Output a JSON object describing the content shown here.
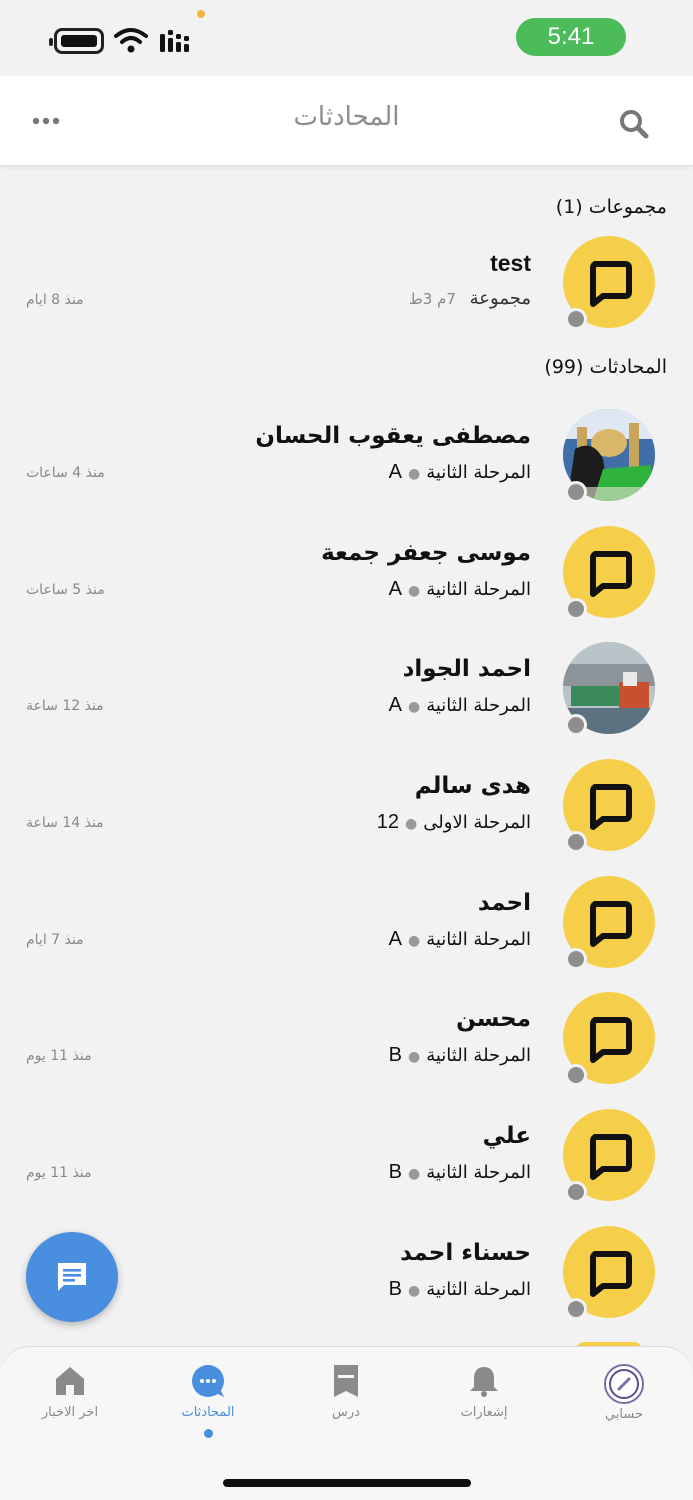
{
  "status_bar": {
    "time": "5:41",
    "icons": [
      "battery-icon",
      "wifi-icon",
      "signal-icon"
    ],
    "time_pill_color": "#4cbb5a"
  },
  "header": {
    "title": "المحادثات",
    "left_icon": "more-icon",
    "right_icon": "search-icon"
  },
  "groups_section": {
    "heading": "مجموعات (1)",
    "items": [
      {
        "name": "test",
        "label": "مجموعة",
        "meta": "7م 3ط",
        "time": "منذ 8 ايام",
        "avatar": "chat-bubble-icon"
      }
    ]
  },
  "chats_section": {
    "heading": "المحادثات (99)",
    "items": [
      {
        "name": "مصطفى يعقوب الحسان",
        "stage": "المرحلة الثانية",
        "section": "A",
        "time": "منذ 4 ساعات",
        "avatar": "photo-mosque"
      },
      {
        "name": "موسى جعفر جمعة",
        "stage": "المرحلة الثانية",
        "section": "A",
        "time": "منذ 5 ساعات",
        "avatar": "chat-bubble-icon"
      },
      {
        "name": "احمد الجواد",
        "stage": "المرحلة الثانية",
        "section": "A",
        "time": "منذ 12 ساعة",
        "avatar": "photo-ship"
      },
      {
        "name": "هدى سالم",
        "stage": "المرحلة الاولى",
        "section": "12",
        "time": "منذ 14 ساعة",
        "avatar": "chat-bubble-icon"
      },
      {
        "name": "احمد",
        "stage": "المرحلة الثانية",
        "section": "A",
        "time": "منذ 7 ايام",
        "avatar": "chat-bubble-icon"
      },
      {
        "name": "محسن",
        "stage": "المرحلة الثانية",
        "section": "B",
        "time": "منذ 11 يوم",
        "avatar": "chat-bubble-icon"
      },
      {
        "name": "علي",
        "stage": "المرحلة الثانية",
        "section": "B",
        "time": "منذ 11 يوم",
        "avatar": "chat-bubble-icon"
      },
      {
        "name": "حسناء احمد",
        "stage": "المرحلة الثانية",
        "section": "B",
        "time": "",
        "avatar": "chat-bubble-icon"
      }
    ]
  },
  "fab": {
    "icon": "message-icon",
    "color": "#4a8ee0"
  },
  "bottom_nav": {
    "items": [
      {
        "label": "اخر الاخبار",
        "icon": "home-icon"
      },
      {
        "label": "المحادثات",
        "icon": "chat-icon",
        "active": true
      },
      {
        "label": "درس",
        "icon": "book-icon"
      },
      {
        "label": "إشعارات",
        "icon": "bell-icon"
      },
      {
        "label": "حسابي",
        "icon": "profile-icon"
      }
    ]
  },
  "colors": {
    "accent": "#4a8ee0",
    "avatar_yellow": "#f5cf4a",
    "background": "#f2f2f2",
    "presence_gray": "#8e8e8e"
  }
}
